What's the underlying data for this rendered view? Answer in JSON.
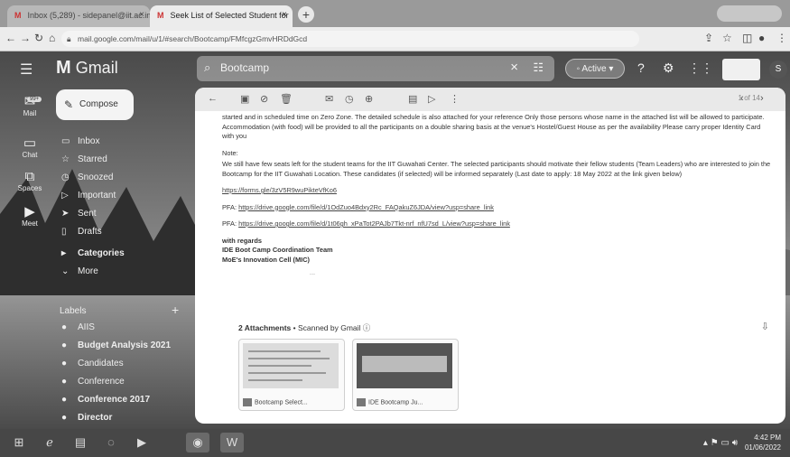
{
  "browser": {
    "tabs": [
      {
        "label": "Inbox (5,289) - sidepanel@iit.ac.in",
        "close": "×"
      },
      {
        "label": "Seek List of Selected Student for",
        "close": "×"
      }
    ],
    "new_tab": "+",
    "url": "mail.google.com/mail/u/1/#search/Bootcamp/FMfcgzGmvHRDdGcd"
  },
  "header": {
    "app_name": "Gmail",
    "search_query": "Bootcamp",
    "status": "Active",
    "avatar_letter": "S"
  },
  "rail": [
    {
      "label": "Mail",
      "badge": "99+"
    },
    {
      "label": "Chat"
    },
    {
      "label": "Spaces"
    },
    {
      "label": "Meet"
    }
  ],
  "sidebar": {
    "compose": "Compose",
    "items": [
      {
        "label": "Inbox",
        "icon": "inbox-icon"
      },
      {
        "label": "Starred",
        "icon": "star-icon"
      },
      {
        "label": "Snoozed",
        "icon": "clock-icon"
      },
      {
        "label": "Important",
        "icon": "label-icon"
      },
      {
        "label": "Sent",
        "icon": "send-icon"
      },
      {
        "label": "Drafts",
        "icon": "file-icon"
      },
      {
        "label": "Categories",
        "icon": "tag-icon"
      },
      {
        "label": "More",
        "icon": "chevron-down-icon"
      }
    ],
    "labels_header": "Labels",
    "labels": [
      {
        "label": "AIIS"
      },
      {
        "label": "Budget Analysis 2021"
      },
      {
        "label": "Candidates"
      },
      {
        "label": "Conference"
      },
      {
        "label": "Conference 2017"
      },
      {
        "label": "Director"
      }
    ]
  },
  "email": {
    "pager": "1 of 14",
    "para1": "started and in scheduled time on Zero Zone. The detailed schedule is also attached for your reference Only those persons whose name in the attached list will be allowed to participate. Accommodation (with food) will be provided to all the participants on a double sharing basis at the venue's Hostel/Guest House as per the availability Please carry proper Identity Card with you",
    "note_label": "Note:",
    "para2": "We still have few seats left for the student teams for the IIT Guwahati Center. The selected participants should motivate their fellow students (Team Leaders) who are interested to join the Bootcamp for the IIT Guwahati Location. These candidates (if selected) will be informed separately (Last date to apply: 18 May 2022 at the link given below)",
    "link1": "https://forms.gle/3zV5R9wuPikteVfKo6",
    "pfa1_label": "PFA:",
    "pfa1_link": "https://drive.google.com/file/d/1OdZuo4Bdxy2Rc_FAQakuZ6JDA/view?usp=share_link",
    "pfa2_label": "PFA:",
    "pfa2_link": "https://drive.google.com/file/d/1t06gh_xPaTot2PAJb7Tkt-nrf_nfU7sd_L/view?usp=share_link",
    "regards": "with regards",
    "sig1": "IDE Boot Camp Coordination Team",
    "sig2": "MoE's Innovation Cell (MIC)",
    "ellipsis": "...",
    "attachments_count": "2 Attachments",
    "scanned": " • Scanned by Gmail ⓘ",
    "attachments": [
      {
        "name": "Bootcamp Select..."
      },
      {
        "name": "IDE Bootcamp Ju..."
      }
    ]
  },
  "taskbar": {
    "time": "4:42 PM",
    "date": "01/06/2022"
  }
}
